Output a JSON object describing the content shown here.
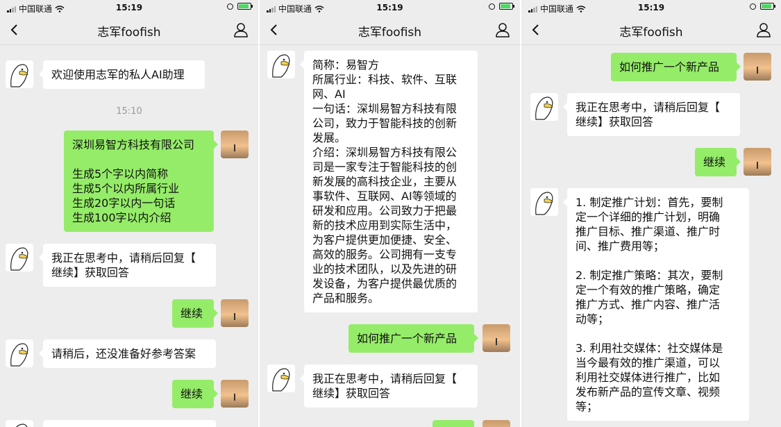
{
  "status_bar": {
    "carrier": "中国联通",
    "time": "15:19"
  },
  "chat_title": "志军foofish",
  "colors": {
    "chat_bg": "#ededed",
    "my_bubble": "#95ec69",
    "bot_bubble": "#ffffff"
  },
  "screen1": {
    "m1": "欢迎使用志军的私人AI助理",
    "ts": "15:10",
    "m2": "深圳易智方科技有限公司\n\n生成5个字以内简称\n生成5个以内所属行业\n生成20字以内一句话\n生成100字以内介绍",
    "m3": "我正在思考中，请稍后回复【\n继续】获取回答",
    "m4": "继续",
    "m5": "请稍后，还没准备好参考答案",
    "m6": "继续"
  },
  "screen2": {
    "m1": "简称：易智方\n所属行业：科技、软件、互联\n网、AI\n一句话：深圳易智方科技有限\n公司，致力于智能科技的创新\n发展。\n介绍：深圳易智方科技有限公\n司是一家专注于智能科技的创\n新发展的高科技企业，主要从\n事软件、互联网、AI等领域的\n研发和应用。公司致力于把最\n新的技术应用到实际生活中，\n为客户提供更加便捷、安全、\n高效的服务。公司拥有一支专\n业的技术团队，以及先进的研\n发设备，为客户提供最优质的\n产品和服务。",
    "m2": "如何推广一个新产品",
    "m3": "我正在思考中，请稍后回复【\n继续】获取回答"
  },
  "screen3": {
    "m1": "如何推广一个新产品",
    "m2": "我正在思考中，请稍后回复【\n继续】获取回答",
    "m3": "继续",
    "m4": "1. 制定推广计划：首先，要制\n定一个详细的推广计划，明确\n推广目标、推广渠道、推广时\n间、推广费用等；\n\n2. 制定推广策略：其次，要制\n定一个有效的推广策略，确定\n推广方式、推广内容、推广活\n动等；\n\n3. 利用社交媒体：社交媒体是\n当今最有效的推广渠道，可以\n利用社交媒体进行推广，比如\n发布新产品的宣传文章、视频\n等；"
  }
}
